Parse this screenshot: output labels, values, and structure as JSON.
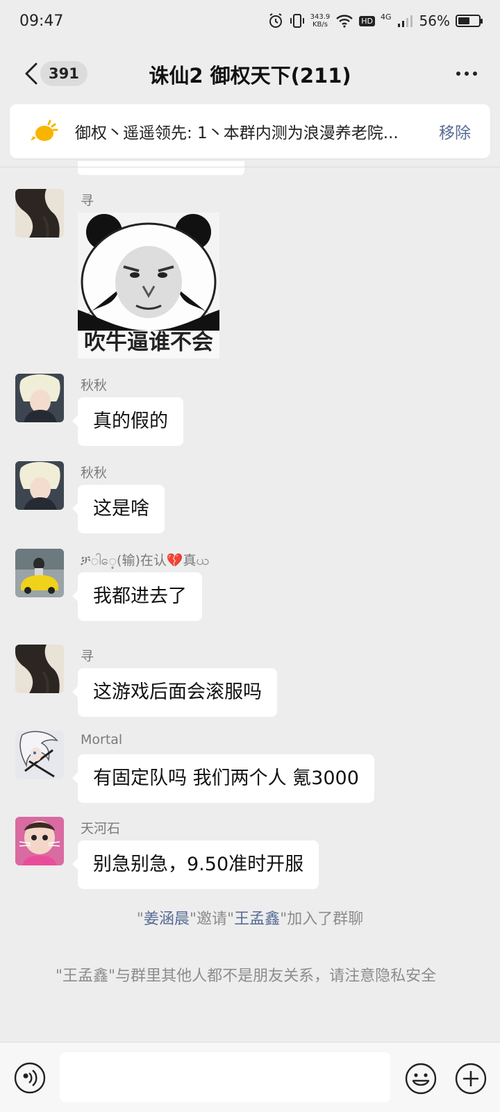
{
  "status": {
    "time": "09:47",
    "speed_value": "343.9",
    "speed_unit": "KB/s",
    "hd": "HD",
    "network": "4G",
    "battery": "56%",
    "battery_level": 0.56
  },
  "header": {
    "unread_count": "391",
    "title": "诛仙2  御权天下(211)"
  },
  "notice": {
    "text": "御权丶遥遥领先: 1丶本群内测为浪漫养老院...",
    "action": "移除"
  },
  "messages": [
    {
      "sender": "寻",
      "sticker_caption": "吹牛逼谁不会"
    },
    {
      "sender": "秋秋",
      "text": "真的假的"
    },
    {
      "sender": "秋秋",
      "text": "这是啥"
    },
    {
      "sender": "ቻါေ့(输)在认💔真ယ",
      "text": "我都进去了"
    },
    {
      "sender": "寻",
      "text": "这游戏后面会滚服吗"
    },
    {
      "sender": "Mortal",
      "text": "有固定队吗 我们两个人 氪3000"
    },
    {
      "sender": "天河石",
      "text": "别急别急，9.50准时开服"
    }
  ],
  "system": {
    "invite_q1": "\"",
    "inviter": "姜涵晨",
    "invite_mid": "\"邀请\"",
    "invitee": "王孟鑫",
    "invite_end": "\"加入了群聊",
    "privacy_notice": "\"王孟鑫\"与群里其他人都不是朋友关系，请注意隐私安全"
  },
  "colors": {
    "background": "#ededed",
    "link": "#576b95",
    "bubble": "#ffffff"
  }
}
